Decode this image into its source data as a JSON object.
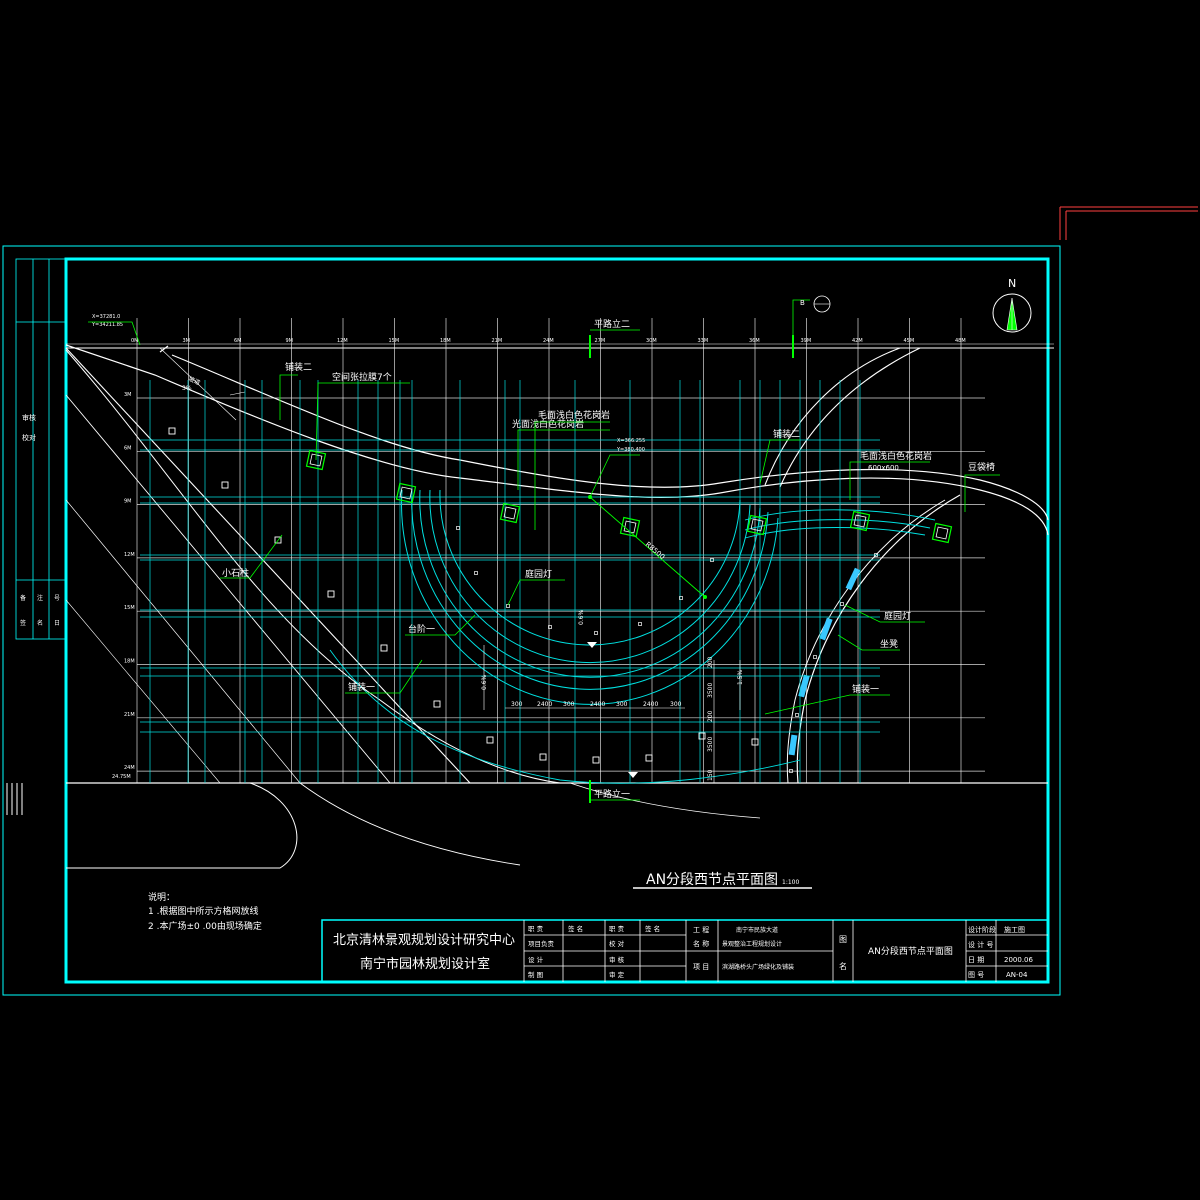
{
  "drawing": {
    "title": "AN分段西节点平面图",
    "scale": "1:100",
    "north": "N",
    "colors": {
      "frame": "#00ffff",
      "grid": "#ffffff",
      "leader": "#00ff00",
      "detail": "#00e0e0",
      "red": "#ff4040"
    }
  },
  "grid_labels": {
    "top": [
      "0M",
      "3M",
      "6M",
      "9M",
      "12M",
      "15M",
      "18M",
      "21M",
      "24M",
      "27M",
      "30M",
      "33M",
      "36M",
      "39M",
      "42M",
      "45M",
      "48M"
    ],
    "left": [
      "3M",
      "6M",
      "9M",
      "12M",
      "15M",
      "18M",
      "21M",
      "24M"
    ],
    "left_bottom": "24.75M",
    "coord_top": [
      "X=37281.0",
      "Y=34211.85"
    ]
  },
  "labels": {
    "pave2_top": "铺装二",
    "tent": "空间张拉膜7个",
    "granite_light": "光面浅白色花岗岩",
    "granite_rough": "毛面浅白色花岗岩",
    "pave2_right": "铺装二",
    "granite_rough_right": "毛面浅白色花岗岩",
    "granite_size": "600x600",
    "chair": "豆袋椅",
    "stone_post": "小石柱",
    "garden_lamp_left": "庭园灯",
    "steps": "台阶一",
    "pave1_left": "铺装一",
    "garden_lamp_right": "庭园灯",
    "bench": "坐凳",
    "pave1_right": "铺装一",
    "section2": "平路立二",
    "section1": "平路立一",
    "radius": "R8500",
    "point_coords": [
      "X=366.255",
      "Y=380.400"
    ],
    "slope_a": "0.6%",
    "slope_b": "0.6%",
    "slope_c": "1.5%",
    "left_small": "坡道",
    "left_small2": "3%",
    "top_cross": "B"
  },
  "dims": {
    "bottom": [
      "300",
      "2400",
      "300",
      "2400",
      "300",
      "2400",
      "300"
    ],
    "right": [
      "200",
      "3500",
      "200",
      "3500",
      "150"
    ]
  },
  "notes": {
    "heading": "说明：",
    "items": [
      "1 .根据图中所示方格网放线",
      "2 .本广场±0 .00由现场确定"
    ]
  },
  "title_block": {
    "org1": "北京清林景观规划设计研究中心",
    "org2": "南宁市园林规划设计室",
    "row_labels": [
      [
        "职  责",
        "签  名",
        "职  责",
        "签  名"
      ],
      [
        "项目负责",
        "",
        "校  对",
        ""
      ],
      [
        "设  计",
        "",
        "审  核",
        ""
      ],
      [
        "制  图",
        "",
        "审  定",
        ""
      ]
    ],
    "project_label_a": "工  程",
    "project_label_b": "名  称",
    "project_name1": "南宁市民族大道",
    "project_name2": "景观整治工程规划设计",
    "item_label": "项  目",
    "item_name": "滨湖路桥头广场绿化及铺装",
    "figname_label_a": "图",
    "figname_label_b": "名",
    "figname": "AN分段西节点平面图",
    "stage_label": "设计阶段",
    "stage": "施工图",
    "no_label": "设 计 号",
    "date_label": "日  期",
    "date": "2000.06",
    "sheet_label": "图  号",
    "sheet": "AN-04"
  },
  "left_strip": {
    "a": "审核",
    "b": "校对",
    "c": [
      "备",
      "注",
      "号"
    ],
    "d": [
      "签",
      "名",
      "日"
    ]
  }
}
